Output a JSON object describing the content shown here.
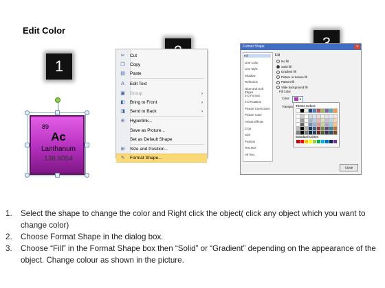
{
  "title": "Edit Color",
  "badges": [
    "1",
    "2",
    "3"
  ],
  "element": {
    "number": "89",
    "symbol": "Ac",
    "name": "Lanthanum",
    "mass": "138.9054"
  },
  "menu": {
    "items": [
      {
        "label": "Cut",
        "icon": "scissors-icon",
        "u": 2
      },
      {
        "label": "Copy",
        "icon": "copy-icon",
        "u": 0
      },
      {
        "label": "Paste",
        "icon": "paste-icon",
        "u": 0
      },
      {
        "label": "Edit Text",
        "icon": "edit-text-icon"
      },
      {
        "label": "Group",
        "icon": "group-icon",
        "disabled": true,
        "submenu": true
      },
      {
        "label": "Bring to Front",
        "icon": "bring-front-icon",
        "submenu": true
      },
      {
        "label": "Send to Back",
        "icon": "send-back-icon",
        "submenu": true
      },
      {
        "label": "Hyperlink...",
        "icon": "hyperlink-icon"
      },
      {
        "label": "Save as Picture...",
        "icon": ""
      },
      {
        "label": "Set as Default Shape",
        "icon": ""
      },
      {
        "label": "Size and Position...",
        "icon": "size-position-icon"
      },
      {
        "label": "Format Shape...",
        "icon": "format-shape-icon",
        "highlighted": true
      }
    ]
  },
  "dialog": {
    "title": "Format Shape",
    "close_glyph": "x",
    "categories": [
      "Fill",
      "Line Color",
      "Line Style",
      "Shadow",
      "Reflection",
      "Glow and Soft Edges",
      "3-D Format",
      "3-D Rotation",
      "Picture Corrections",
      "Picture Color",
      "Artistic Effects",
      "Crop",
      "Size",
      "Position",
      "Text Box",
      "Alt Text"
    ],
    "heading": "Fill",
    "options": [
      "No fill",
      "Solid fill",
      "Gradient fill",
      "Picture or texture fill",
      "Pattern fill",
      "Slide background fill"
    ],
    "selected_option": "Solid fill",
    "fill_color_label": "Fill Color",
    "color_label": "Color:",
    "transparency_label": "Transparency:",
    "theme_colors_label": "Theme Colors",
    "standard_colors_label": "Standard Colors",
    "close_label": "Close"
  },
  "instructions": [
    {
      "n": "1.",
      "text": "Select the shape to change the color and Right click the object( click any object which you want to change color)"
    },
    {
      "n": "2.",
      "text": "Choose Format Shape in the dialog box."
    },
    {
      "n": "3.",
      "text": "Choose “Fill” in the Format Shape box then “Solid” or “Gradient” depending on the appearance of the object. Change colour as shown in the picture."
    }
  ],
  "colors": {
    "tile_top": "#e35ee6",
    "tile_bottom": "#7d1785",
    "badge": "#111111",
    "menu_highlight": "#fbd977",
    "dialog_title_bar": "#3f6ec4",
    "theme_palette": [
      "#ffffff",
      "#000000",
      "#eeece1",
      "#1f497d",
      "#4f81bd",
      "#c0504d",
      "#9bbb59",
      "#8064a2",
      "#4bacc6",
      "#f79646"
    ],
    "standard_palette": [
      "#c00000",
      "#ff0000",
      "#ffc000",
      "#ffff00",
      "#92d050",
      "#00b050",
      "#00b0f0",
      "#0070c0",
      "#002060",
      "#7030a0"
    ]
  }
}
